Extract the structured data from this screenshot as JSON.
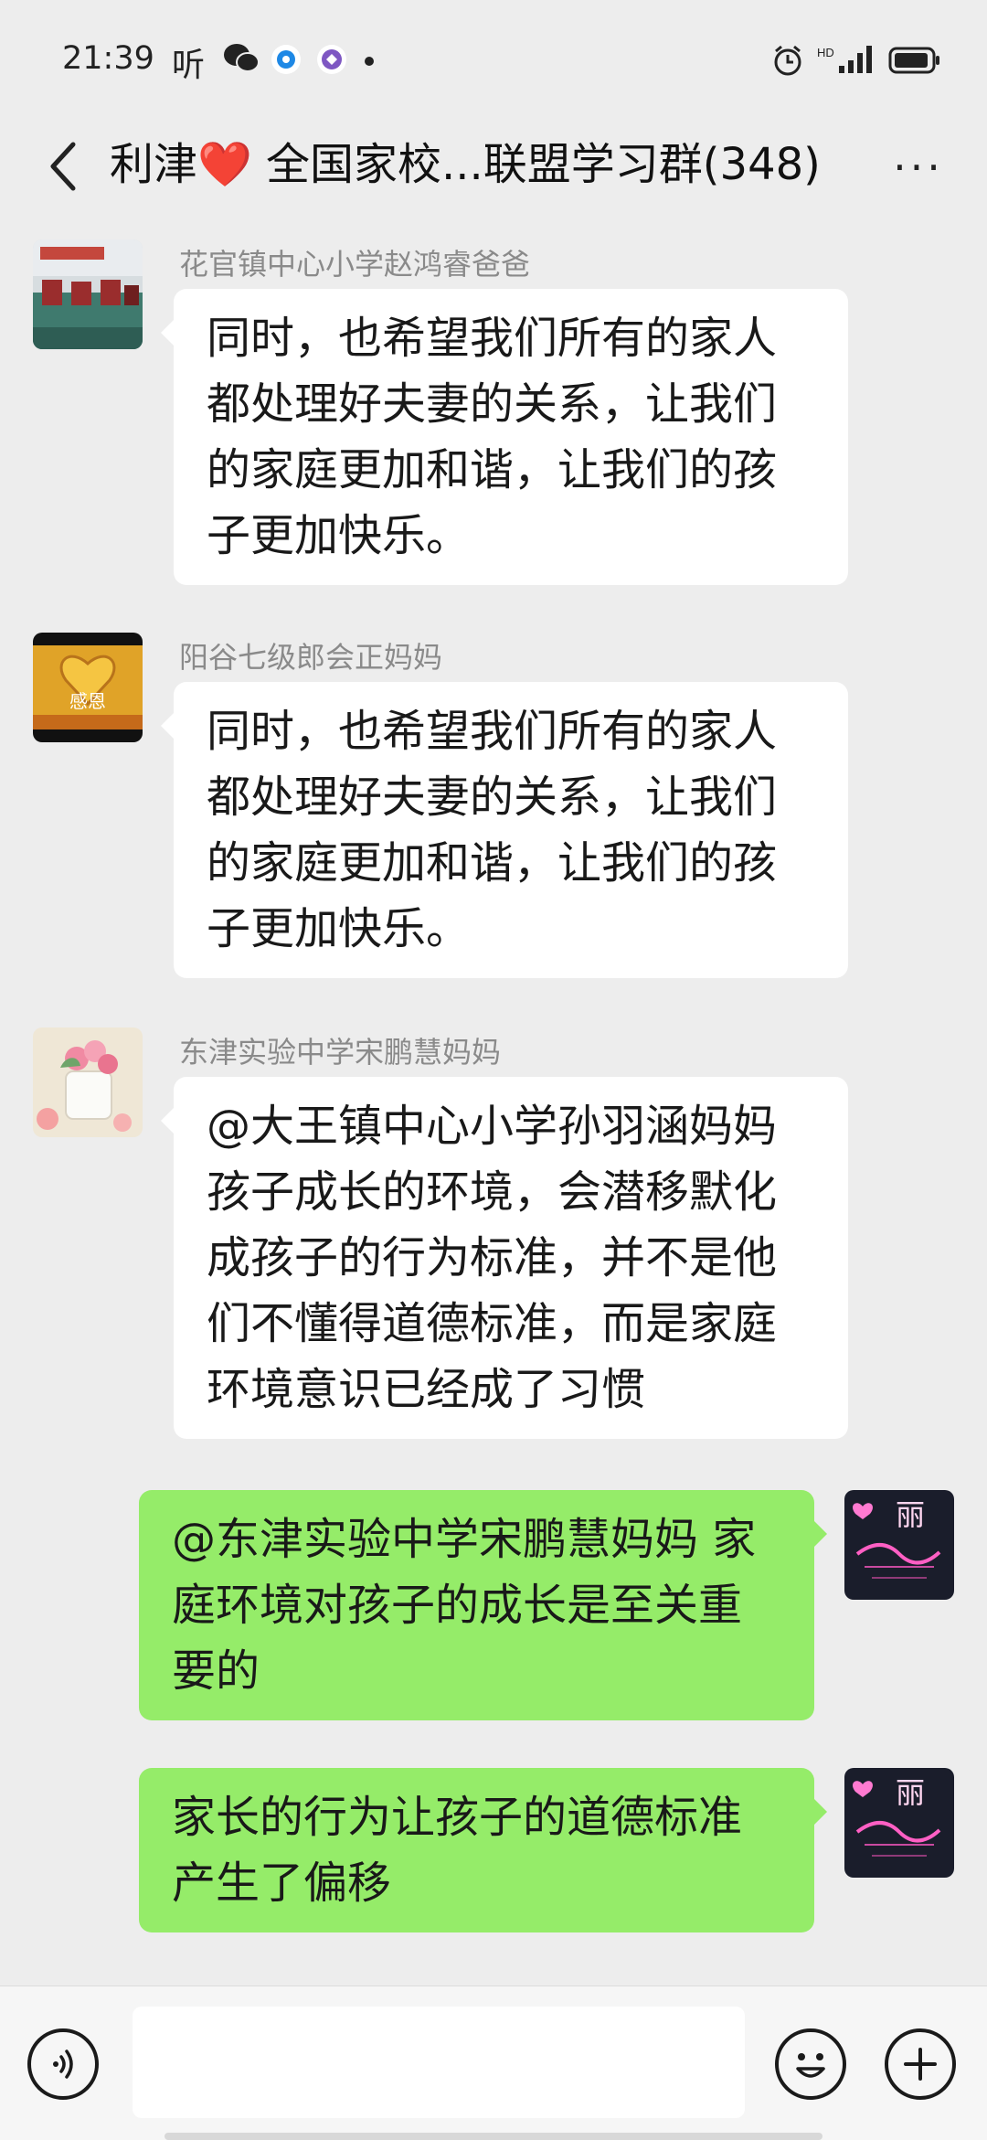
{
  "status_bar": {
    "time": "21:39",
    "ting": "听",
    "left_icons": [
      "wechat-icon",
      "browser-icon",
      "app-icon",
      "notification-dot-icon"
    ],
    "right_icons": [
      "alarm-icon",
      "hd-signal-icon",
      "battery-icon"
    ]
  },
  "header": {
    "title": "利津❤️ 全国家校...联盟学习群(348)",
    "more_label": "···"
  },
  "messages": [
    {
      "direction": "incoming",
      "sender": "花官镇中心小学赵鸿睿爸爸",
      "lines": [
        "同时，也希望我们所有的家人",
        "都处理好夫妻的关系，让我们",
        "的家庭更加和谐，让我们的孩",
        "子更加快乐。"
      ]
    },
    {
      "direction": "incoming",
      "sender": "阳谷七级郎会正妈妈",
      "avatar_text": "感恩",
      "lines": [
        "同时，也希望我们所有的家人",
        "都处理好夫妻的关系，让我们",
        "的家庭更加和谐，让我们的孩",
        "子更加快乐。"
      ]
    },
    {
      "direction": "incoming",
      "sender": "东津实验中学宋鹏慧妈妈",
      "lines": [
        "@大王镇中心小学孙羽涵妈妈",
        "孩子成长的环境，会潜移默化",
        "成孩子的行为标准，并不是他",
        "们不懂得道德标准，而是家庭",
        "环境意识已经成了习惯"
      ]
    },
    {
      "direction": "outgoing",
      "avatar_text": "丽",
      "lines": [
        "@东津实验中学宋鹏慧妈妈  家",
        "庭环境对孩子的成长是至关重",
        "要的"
      ]
    },
    {
      "direction": "outgoing",
      "avatar_text": "丽",
      "lines": [
        "家长的行为让孩子的道德标准",
        "产生了偏移"
      ]
    }
  ],
  "input_bar": {
    "placeholder": "",
    "icons": [
      "voice-icon",
      "emoji-icon",
      "plus-icon"
    ]
  },
  "colors": {
    "background": "#ededed",
    "incoming_bubble": "#ffffff",
    "outgoing_bubble": "#95ec69",
    "sender_name": "#8a8a8a"
  }
}
